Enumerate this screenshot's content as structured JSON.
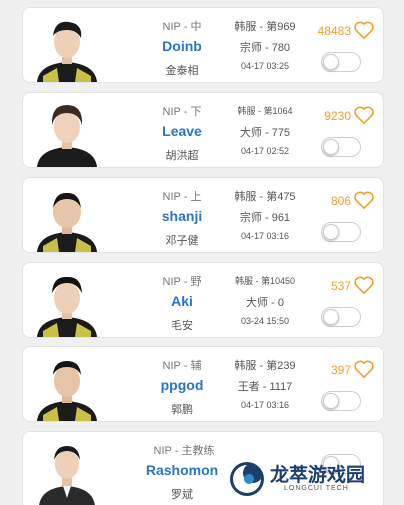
{
  "players": [
    {
      "team": "NIP - 中",
      "name": "Doinb",
      "realname": "金泰相",
      "server": "韩服 - 第969",
      "rank": "宗师 - 780",
      "time": "04-17 03:25",
      "likes": "48483",
      "toggle_on": false
    },
    {
      "team": "NIP - 下",
      "name": "Leave",
      "realname": "胡洪超",
      "server": "韩服 - 第1064",
      "rank": "大师 - 775",
      "time": "04-17 02:52",
      "likes": "9230",
      "toggle_on": false
    },
    {
      "team": "NIP - 上",
      "name": "shanji",
      "realname": "邓子健",
      "server": "韩服 - 第475",
      "rank": "宗师 - 961",
      "time": "04-17 03:16",
      "likes": "806",
      "toggle_on": false
    },
    {
      "team": "NIP - 野",
      "name": "Aki",
      "realname": "毛安",
      "server": "韩服 - 第10450",
      "rank": "大师 - 0",
      "time": "03-24 15:50",
      "likes": "537",
      "toggle_on": false
    },
    {
      "team": "NIP - 辅",
      "name": "ppgod",
      "realname": "郭鹏",
      "server": "韩服 - 第239",
      "rank": "王者 - 1117",
      "time": "04-17 03:16",
      "likes": "397",
      "toggle_on": false
    },
    {
      "team": "NIP - 主教练",
      "name": "Rashomon",
      "realname": "罗斌",
      "toggle_on": false
    }
  ],
  "watermark": {
    "name": "龙萃游戏园",
    "sub": "LONGCUI TECH"
  },
  "colors": {
    "accent_name": "#2a76c6",
    "likes": "#f0a030",
    "heart": "#f0a030"
  }
}
